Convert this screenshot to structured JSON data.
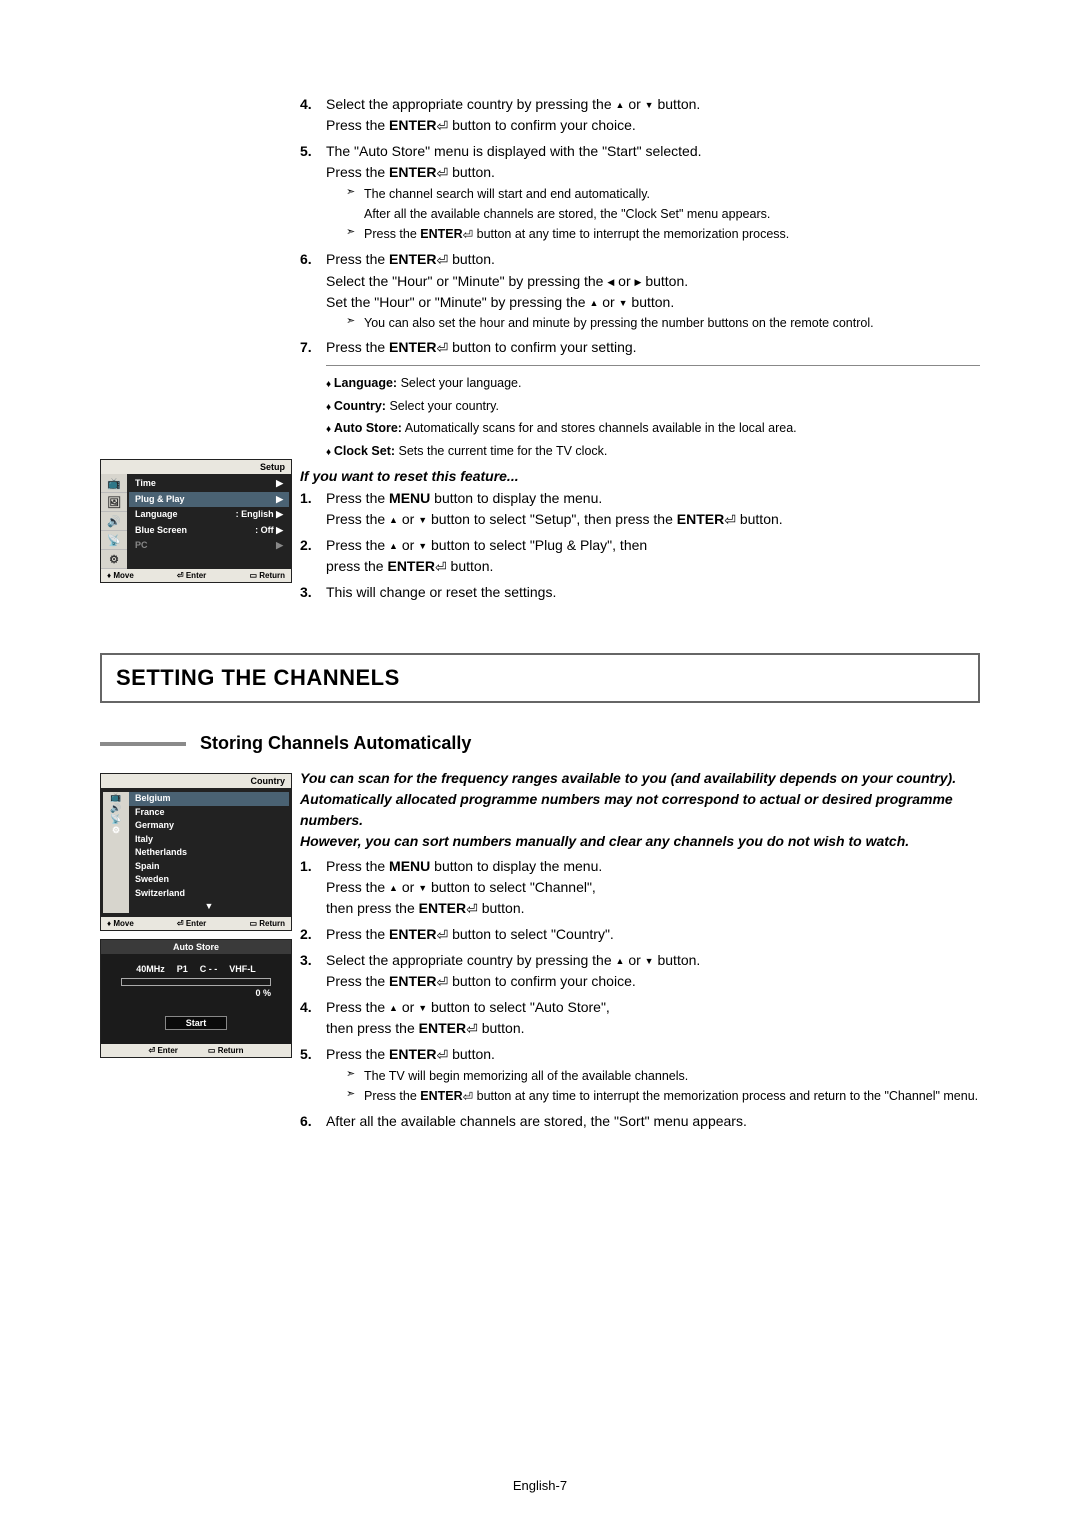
{
  "footer": "English-7",
  "enter_glyph": "↵",
  "top": {
    "step4_a": "Select the appropriate country by pressing the ",
    "step4_b": " or ",
    "step4_c": " button.",
    "step4_d": "Press the ",
    "step4_e": "ENTER",
    "step4_f": " button to confirm your choice.",
    "step5_a": "The \"Auto Store\" menu is displayed with the \"Start\" selected.",
    "step5_b": "Press the ",
    "step5_c": "ENTER",
    "step5_d": " button.",
    "step5_note1": "The channel search will start and end automatically.",
    "step5_note1b": "After all the available channels are stored, the \"Clock Set\" menu appears.",
    "step5_note2a": "Press the ",
    "step5_note2b": "ENTER",
    "step5_note2c": " button at any time to interrupt the memorization process.",
    "step6_a": "Press the ",
    "step6_b": "ENTER",
    "step6_c": " button.",
    "step6_d": "Select the \"Hour\" or \"Minute\" by pressing the ",
    "step6_e": " or ",
    "step6_f": " button.",
    "step6_g": "Set the \"Hour\" or \"Minute\" by pressing the ",
    "step6_h": " or ",
    "step6_i": " button.",
    "step6_note": "You can also set the hour and minute by pressing the number buttons on the remote control.",
    "step7_a": "Press the ",
    "step7_b": "ENTER",
    "step7_c": " button to confirm your setting.",
    "b1a": "Language:",
    "b1b": " Select your language.",
    "b2a": "Country:",
    "b2b": " Select your country.",
    "b3a": "Auto Store:",
    "b3b": " Automatically scans for and stores channels available in the local area.",
    "b4a": "Clock Set:",
    "b4b": " Sets the current time for the TV clock.",
    "reset_title": "If you want to reset this feature...",
    "r1_a": "Press the ",
    "r1_b": "MENU",
    "r1_c": " button to display the menu.",
    "r1_d": "Press the ",
    "r1_e": " or ",
    "r1_f": " button to select \"Setup\", then press the ",
    "r1_g": "ENTER",
    "r1_h": " button.",
    "r2_a": "Press the ",
    "r2_b": " or ",
    "r2_c": " button to select \"Plug & Play\", then",
    "r2_d": "press the ",
    "r2_e": "ENTER",
    "r2_f": " button.",
    "r3": "This will change or reset the settings."
  },
  "section_bar": "SETTING THE CHANNELS",
  "subheading": "Storing Channels Automatically",
  "intro": "You can scan for the frequency ranges available to you (and availability depends on your country). Automatically allocated programme numbers may not correspond to actual or desired programme numbers.\nHowever, you can sort numbers manually and clear any channels you do not wish to watch.",
  "bottom": {
    "s1_a": "Press the ",
    "s1_b": "MENU",
    "s1_c": " button to display the menu.",
    "s1_d": "Press the ",
    "s1_e": " or ",
    "s1_f": " button to select \"Channel\",",
    "s1_g": "then press the ",
    "s1_h": "ENTER",
    "s1_i": " button.",
    "s2_a": "Press the ",
    "s2_b": "ENTER",
    "s2_c": " button to select \"Country\".",
    "s3_a": "Select the appropriate country by pressing the ",
    "s3_b": " or ",
    "s3_c": " button.",
    "s3_d": "Press the ",
    "s3_e": "ENTER",
    "s3_f": " button to confirm your choice.",
    "s4_a": "Press the ",
    "s4_b": " or ",
    "s4_c": " button to select \"Auto Store\",",
    "s4_d": "then press the ",
    "s4_e": "ENTER",
    "s4_f": " button.",
    "s5_a": "Press the ",
    "s5_b": "ENTER",
    "s5_c": " button.",
    "s5_note1": "The TV will begin memorizing all of the available channels.",
    "s5_note2a": "Press the ",
    "s5_note2b": "ENTER",
    "s5_note2c": " button at any time to interrupt the memorization process and return to the \"Channel\" menu.",
    "s6": "After all the available channels are stored, the \"Sort\" menu appears."
  },
  "osd_setup": {
    "title": "Setup",
    "rows": [
      {
        "label": "Time",
        "value": "",
        "arrow": true
      },
      {
        "label": "Plug & Play",
        "value": "",
        "arrow": true,
        "hl": true
      },
      {
        "label": "Language",
        "value": ": English",
        "arrow": true
      },
      {
        "label": "Blue Screen",
        "value": ": Off",
        "arrow": true
      },
      {
        "label": "PC",
        "value": "",
        "arrow": true,
        "dim": true
      }
    ],
    "footer": {
      "move": "Move",
      "enter": "Enter",
      "return": "Return"
    }
  },
  "osd_country": {
    "title": "Country",
    "items": [
      "Belgium",
      "France",
      "Germany",
      "Italy",
      "Netherlands",
      "Spain",
      "Sweden",
      "Switzerland"
    ],
    "more": "▼",
    "footer": {
      "move": "Move",
      "enter": "Enter",
      "return": "Return"
    }
  },
  "osd_store": {
    "title": "Auto Store",
    "chips": [
      "40MHz",
      "P1",
      "C - -",
      "VHF-L"
    ],
    "percent": "0 %",
    "start": "Start",
    "footer": {
      "enter": "Enter",
      "return": "Return"
    }
  }
}
